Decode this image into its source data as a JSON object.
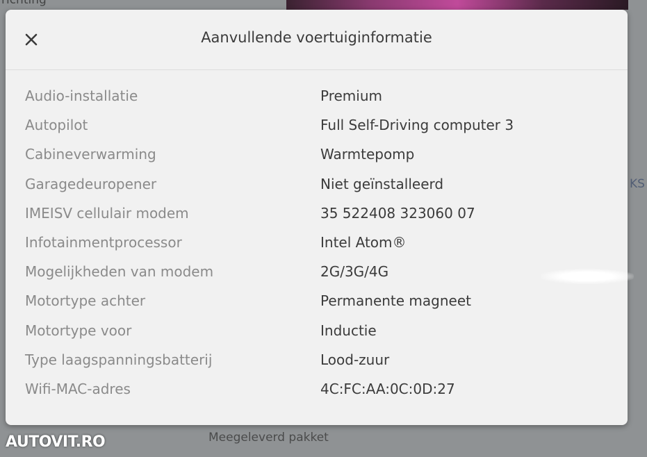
{
  "background": {
    "top_text": "richting",
    "right_text": "KS",
    "bottom_text": "Meegeleverd pakket"
  },
  "watermark": "AUTOVIT.RO",
  "modal": {
    "close_icon": "close-icon",
    "title": "Aanvullende voertuiginformatie",
    "rows": [
      {
        "label": "Audio-installatie",
        "value": "Premium"
      },
      {
        "label": "Autopilot",
        "value": "Full Self-Driving computer 3"
      },
      {
        "label": "Cabineverwarming",
        "value": "Warmtepomp"
      },
      {
        "label": "Garagedeuropener",
        "value": "Niet geïnstalleerd"
      },
      {
        "label": "IMEISV cellulair modem",
        "value": "35 522408 323060 07"
      },
      {
        "label": "Infotainmentprocessor",
        "value": "Intel Atom®"
      },
      {
        "label": "Mogelijkheden van modem",
        "value": "2G/3G/4G"
      },
      {
        "label": "Motortype achter",
        "value": "Permanente magneet"
      },
      {
        "label": "Motortype voor",
        "value": "Inductie"
      },
      {
        "label": "Type laagspanningsbatterij",
        "value": "Lood-zuur"
      },
      {
        "label": "Wifi-MAC-adres",
        "value": "4C:FC:AA:0C:0D:27"
      }
    ]
  }
}
